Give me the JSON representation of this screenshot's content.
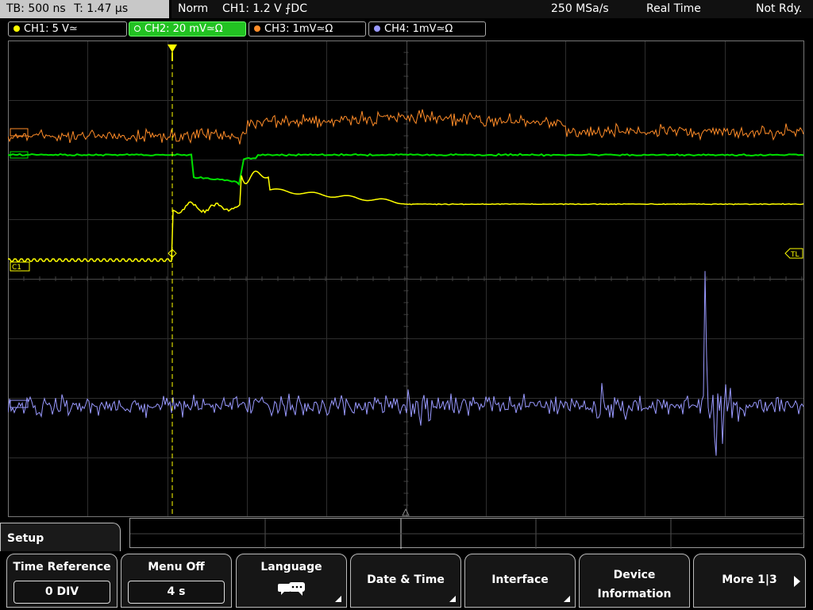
{
  "status": {
    "timebase": "TB: 500 ns",
    "trigger_time": "T: 1.47 µs",
    "mode": "Norm",
    "trigger_info": "CH1: 1.2 V ⨍DC",
    "sample_rate": "250 MSa/s",
    "acq_mode": "Real Time",
    "state": "Not Rdy."
  },
  "channels": [
    {
      "label": "CH1: 5 V≃",
      "color": "#ffff00",
      "active": false
    },
    {
      "label": "CH2: 20 mV≃Ω",
      "color": "#00ff00",
      "active": true
    },
    {
      "label": "CH3: 1mV≃Ω",
      "color": "#ff8c28",
      "active": false
    },
    {
      "label": "CH4: 1mV≃Ω",
      "color": "#9999ff",
      "active": false
    }
  ],
  "markers": {
    "ch1_ref": "C1",
    "trigger_level": "TL"
  },
  "menu": {
    "title": "Setup",
    "items": [
      {
        "label": "Time Reference",
        "value": "0 DIV"
      },
      {
        "label": "Menu Off",
        "value": "4 s"
      },
      {
        "label": "Language",
        "icon": "speech-bubble-icon"
      },
      {
        "label": "Date & Time"
      },
      {
        "label": "Interface"
      },
      {
        "label": "Device",
        "label2": "Information"
      },
      {
        "label": "More 1|3"
      }
    ]
  }
}
